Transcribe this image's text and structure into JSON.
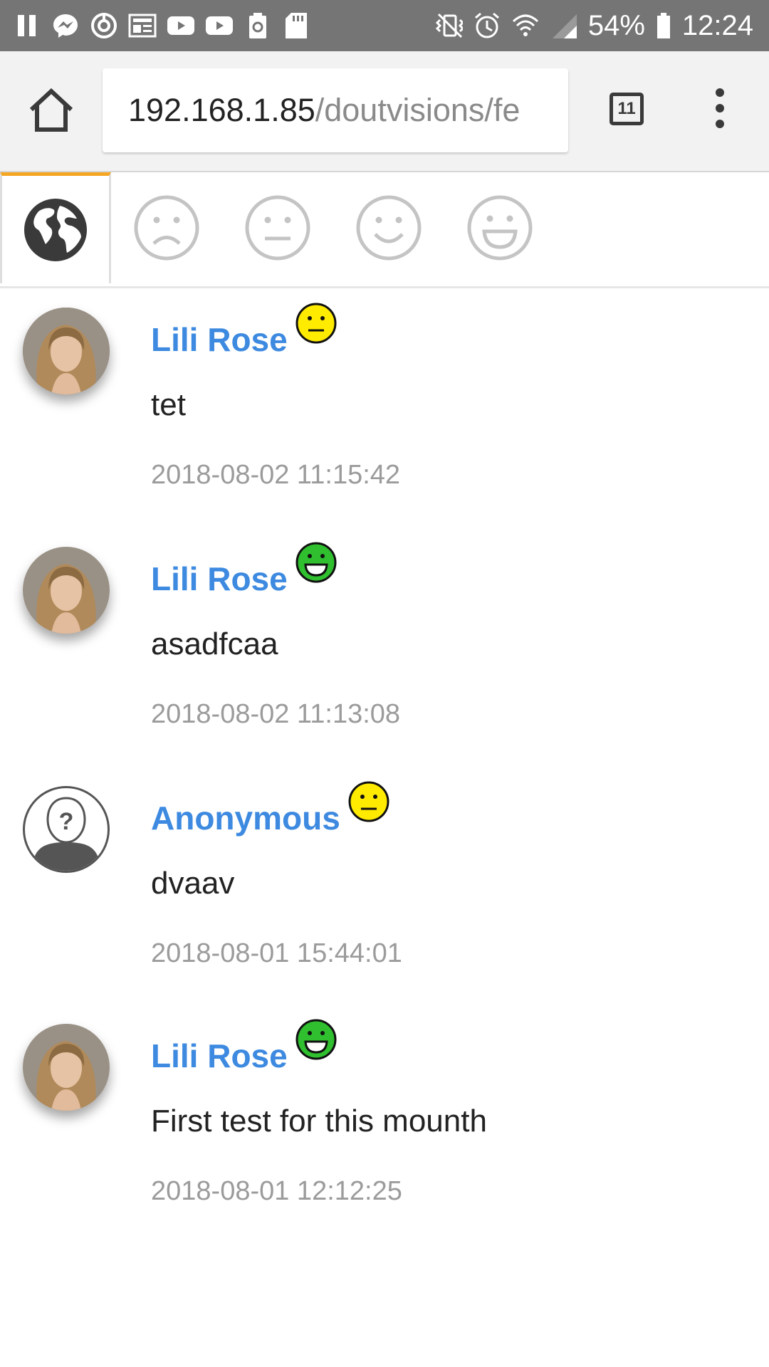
{
  "status_bar": {
    "battery_percent": "54%",
    "time": "12:24",
    "left_icons": [
      "pause-icon",
      "messenger-icon",
      "sync-icon",
      "news-icon",
      "youtube-icon",
      "youtube-icon",
      "battery-saver-icon",
      "sd-card-icon"
    ],
    "right_icons": [
      "vibrate-icon",
      "alarm-icon",
      "wifi-icon",
      "signal-icon",
      "battery-icon"
    ]
  },
  "browser": {
    "url_host": "192.168.1.85",
    "url_path": "/doutvisions/fe",
    "tab_count": "11",
    "icons": [
      "home-icon",
      "tabs-icon",
      "overflow-menu-icon"
    ]
  },
  "filters": {
    "active_index": 0,
    "items": [
      {
        "icon": "globe-icon"
      },
      {
        "icon": "sad-face-icon"
      },
      {
        "icon": "neutral-face-icon"
      },
      {
        "icon": "smile-face-icon"
      },
      {
        "icon": "grin-face-icon"
      }
    ],
    "accent_color": "#f5a623"
  },
  "comments": [
    {
      "author": "Lili Rose",
      "avatar": "photo",
      "mood": "neutral",
      "text": "tet",
      "time": "2018-08-02 11:15:42"
    },
    {
      "author": "Lili Rose",
      "avatar": "photo",
      "mood": "happy",
      "text": "asadfcaa",
      "time": "2018-08-02 11:13:08"
    },
    {
      "author": "Anonymous",
      "avatar": "anonymous",
      "mood": "neutral",
      "text": "dvaav",
      "time": "2018-08-01 15:44:01"
    },
    {
      "author": "Lili Rose",
      "avatar": "photo",
      "mood": "happy",
      "text": "First test for this mounth",
      "time": "2018-08-01 12:12:25"
    }
  ],
  "colors": {
    "author_link": "#3d8ae0",
    "mood_neutral": "#ffeb00",
    "mood_happy": "#2fbf2f",
    "status_bar": "#757575"
  }
}
